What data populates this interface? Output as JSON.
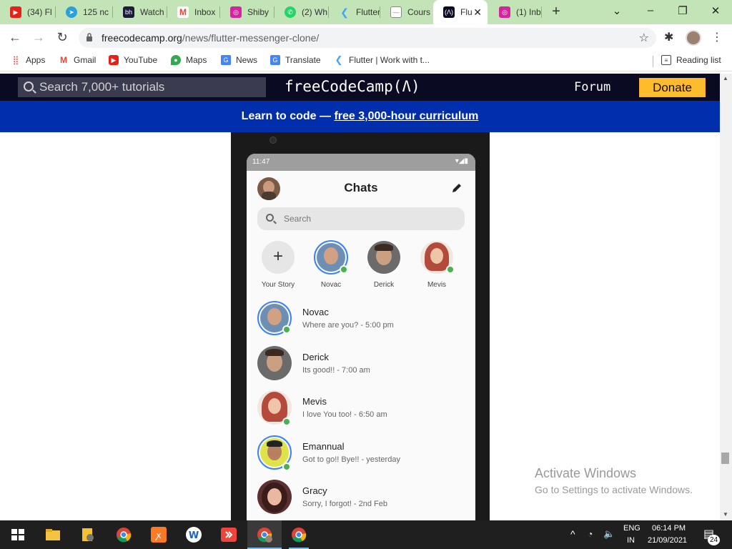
{
  "tabs": [
    {
      "label": "(34) Fl",
      "icon": "youtube-icon",
      "color": "#e62117"
    },
    {
      "label": "125 nc",
      "icon": "telegram-icon",
      "color": "#2aa1da"
    },
    {
      "label": "Watch",
      "icon": "bh-icon",
      "color": "#1a1a3a"
    },
    {
      "label": "Inbox",
      "icon": "gmail-icon",
      "color": "#ea4335"
    },
    {
      "label": "Shiby",
      "icon": "instagram-icon",
      "color": "#d6249f"
    },
    {
      "label": "(2) Wh",
      "icon": "whatsapp-icon",
      "color": "#25d366"
    },
    {
      "label": "Flutter",
      "icon": "flutter-icon",
      "color": "#42a5f5"
    },
    {
      "label": "Cours",
      "icon": "doc-icon",
      "color": "#888888"
    },
    {
      "label": "Flu",
      "icon": "freecodecamp-icon",
      "color": "#0a0a23"
    },
    {
      "label": "(1) Inb",
      "icon": "instagram-icon",
      "color": "#d6249f"
    }
  ],
  "address": {
    "host": "freecodecamp.org",
    "path": "/news/flutter-messenger-clone/"
  },
  "bookmarks": [
    {
      "label": "Apps",
      "icon": "apps-grid-icon"
    },
    {
      "label": "Gmail",
      "icon": "gmail-icon"
    },
    {
      "label": "YouTube",
      "icon": "youtube-icon"
    },
    {
      "label": "Maps",
      "icon": "maps-icon"
    },
    {
      "label": "News",
      "icon": "news-icon"
    },
    {
      "label": "Translate",
      "icon": "translate-icon"
    },
    {
      "label": "Flutter | Work with t...",
      "icon": "flutter-icon"
    },
    {
      "label": "Reading list",
      "icon": "reading-list-icon"
    }
  ],
  "fcc": {
    "search_placeholder": "Search 7,000+ tutorials",
    "logo": "freeCodeCamp(Ʌ)",
    "forum": "Forum",
    "donate": "Donate",
    "banner_prefix": "Learn to code — ",
    "banner_link": "free 3,000-hour curriculum"
  },
  "app": {
    "status_time": "11:47",
    "title": "Chats",
    "search_placeholder": "Search",
    "stories": [
      {
        "label": "Your Story"
      },
      {
        "label": "Novac"
      },
      {
        "label": "Derick"
      },
      {
        "label": "Mevis"
      }
    ],
    "chats": [
      {
        "name": "Novac",
        "message": "Where are you? - 5:00 pm"
      },
      {
        "name": "Derick",
        "message": "Its good!! - 7:00 am"
      },
      {
        "name": "Mevis",
        "message": "I love You too! - 6:50 am"
      },
      {
        "name": "Emannual",
        "message": "Got to go!! Bye!! - yesterday"
      },
      {
        "name": "Gracy",
        "message": "Sorry, I forgot! - 2nd Feb"
      }
    ]
  },
  "watermark": {
    "line1": "Activate Windows",
    "line2": "Go to Settings to activate Windows."
  },
  "taskbar": {
    "lang1": "ENG",
    "lang2": "IN",
    "time": "06:14 PM",
    "date": "21/09/2021",
    "notifications": "24"
  }
}
